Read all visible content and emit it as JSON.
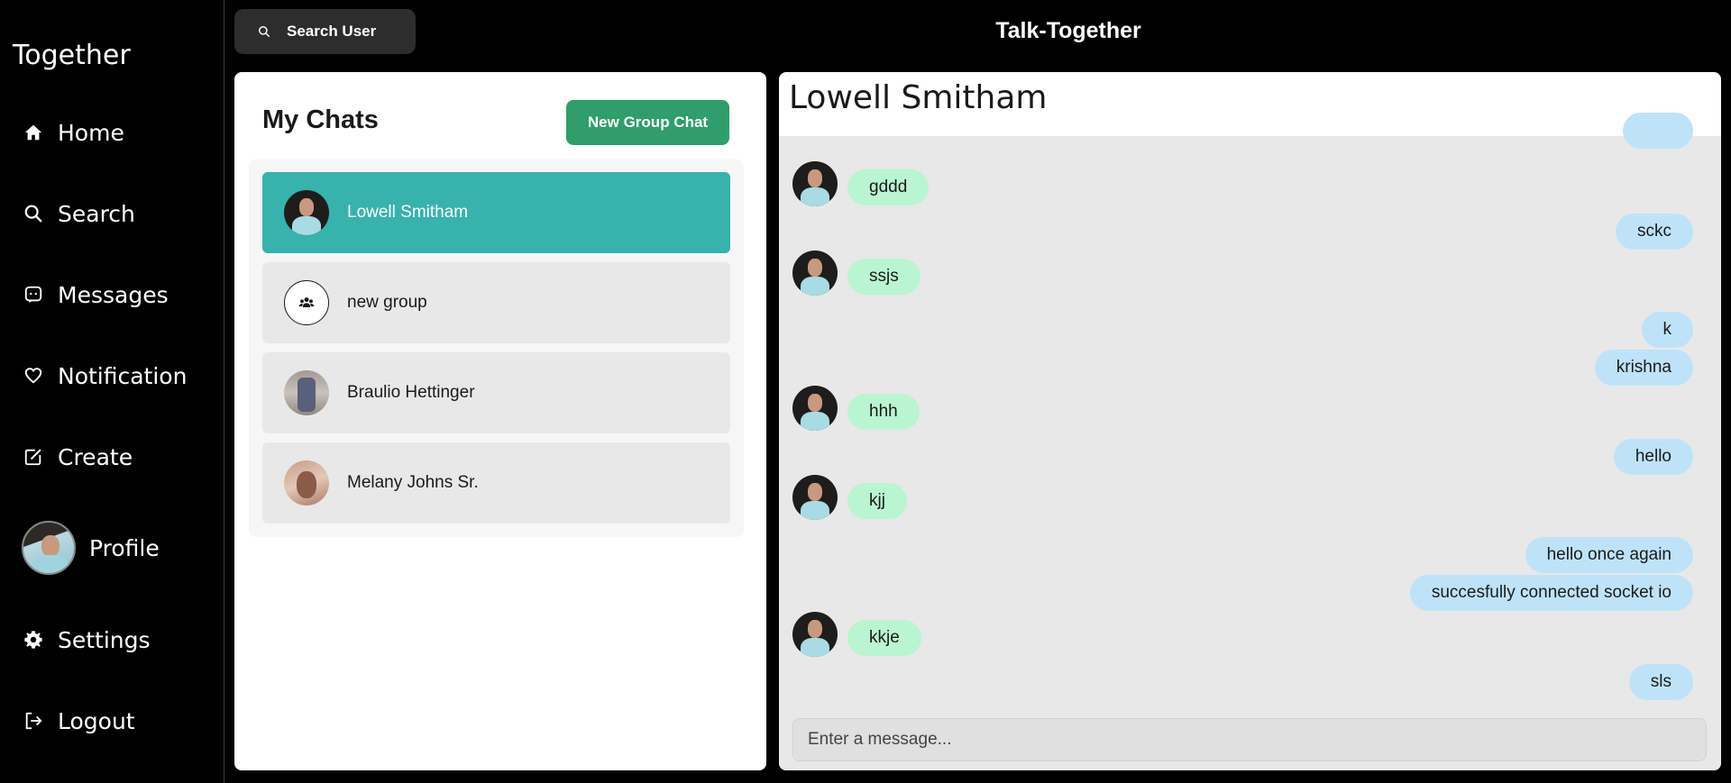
{
  "sidebar": {
    "brand": "Together",
    "items": [
      {
        "label": "Home",
        "icon": "home-icon"
      },
      {
        "label": "Search",
        "icon": "search-icon"
      },
      {
        "label": "Messages",
        "icon": "message-icon"
      },
      {
        "label": "Notification",
        "icon": "heart-icon"
      },
      {
        "label": "Create",
        "icon": "create-icon"
      },
      {
        "label": "Profile",
        "icon": "avatar"
      },
      {
        "label": "Settings",
        "icon": "gear-icon"
      },
      {
        "label": "Logout",
        "icon": "logout-icon"
      }
    ]
  },
  "topbar": {
    "search_label": "Search User",
    "title": "Talk-Together"
  },
  "chats": {
    "title": "My Chats",
    "new_group_label": "New Group Chat",
    "items": [
      {
        "name": "Lowell Smitham",
        "active": true
      },
      {
        "name": "new group",
        "active": false
      },
      {
        "name": "Braulio Hettinger",
        "active": false
      },
      {
        "name": "Melany Johns Sr.",
        "active": false
      }
    ]
  },
  "conversation": {
    "header": "Lowell Smitham",
    "messages": [
      {
        "text": "gddd",
        "direction": "in"
      },
      {
        "text": "sckc",
        "direction": "out"
      },
      {
        "text": "ssjs",
        "direction": "in"
      },
      {
        "text": "k",
        "direction": "out"
      },
      {
        "text": "krishna",
        "direction": "out"
      },
      {
        "text": "hhh",
        "direction": "in"
      },
      {
        "text": "hello",
        "direction": "out"
      },
      {
        "text": "kjj",
        "direction": "in"
      },
      {
        "text": "hello once again",
        "direction": "out"
      },
      {
        "text": "succesfully connected socket io",
        "direction": "out"
      },
      {
        "text": "kkje",
        "direction": "in"
      },
      {
        "text": "sls",
        "direction": "out"
      }
    ],
    "input_placeholder": "Enter a message..."
  },
  "colors": {
    "active_chat": "#38b2ac",
    "new_group_button": "#2f9e6a",
    "incoming_bubble": "#b9f5d0",
    "outgoing_bubble": "#bee3f8"
  }
}
